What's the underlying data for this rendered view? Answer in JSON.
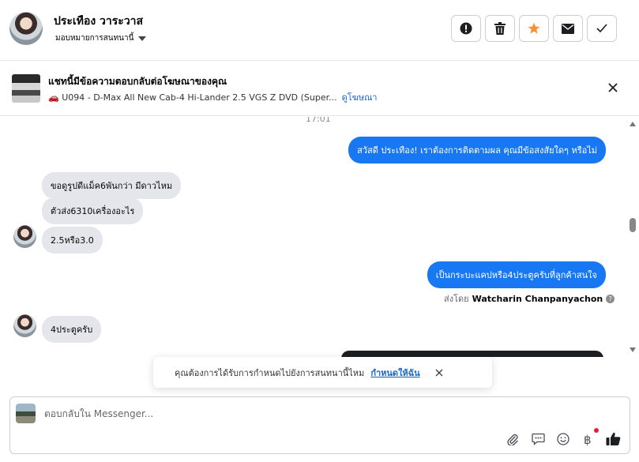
{
  "header": {
    "contact_name": "ประเทือง วาระวาส",
    "assign_label": "มอบหมายการสนทนานี้"
  },
  "ad": {
    "title": "แชทนี้มีข้อความตอบกลับต่อโฆษณาของคุณ",
    "subtitle": "🚗 U094 - D-Max All New Cab-4 Hi-Lander 2.5 VGS Z DVD (Super...",
    "link": "ดูโฆษณา"
  },
  "chat": {
    "timestamp": "17:01",
    "messages": [
      {
        "dir": "out",
        "text": "สวัสดี ประเทือง! เราต้องการติดตามผล คุณมีข้อสงสัยใดๆ หรือไม่"
      },
      {
        "dir": "in",
        "text": "ขอดูรูปดีแม็ค6พันกว่า  มีดาวไหม"
      },
      {
        "dir": "in",
        "text": "ตัวส่ง6310เครื่องอะไร"
      },
      {
        "dir": "in",
        "text": "2.5หรือ3.0"
      },
      {
        "dir": "out",
        "text": "เป็นกระบะแคปหรือ4ประตูครับที่ลูกค้าสนใจ"
      },
      {
        "dir": "in",
        "text": "4ประตูครับ"
      }
    ],
    "sent_by_label": "ส่งโดย",
    "sent_by_name": "Watcharin Chanpanyachon"
  },
  "toast": {
    "text": "คุณต้องการได้รับการกำหนดไปยังการสนทนานี้ไหม",
    "action": "กำหนดให้ฉัน"
  },
  "composer": {
    "placeholder": "ตอบกลับใน Messenger..."
  },
  "colors": {
    "outgoing_bubble": "#1877f2",
    "incoming_bubble": "#e4e6eb",
    "link": "#1a67c5",
    "favorite_star": "#f7923a"
  }
}
